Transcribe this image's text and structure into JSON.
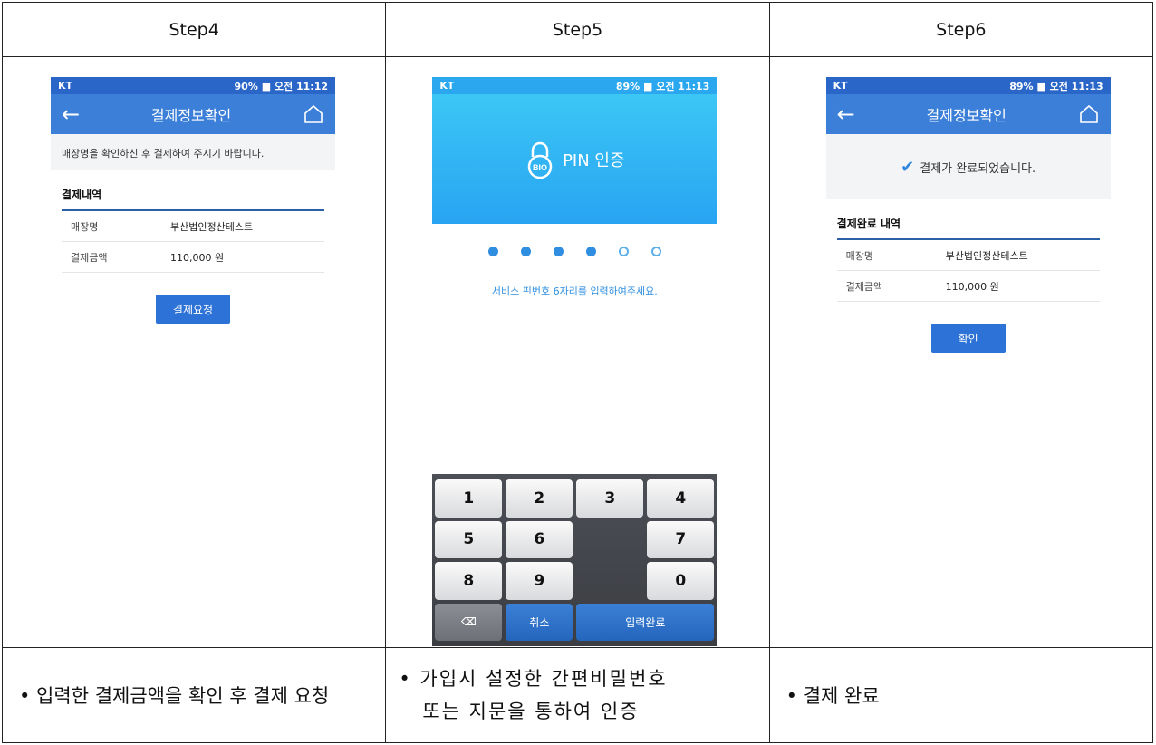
{
  "steps": [
    {
      "label": "Step4",
      "description": "• 입력한 결제금액을 확인 후 결제 요청"
    },
    {
      "label": "Step5",
      "description_line1": "• 가입시 설정한 간편비밀번호",
      "description_line2": "또는 지문을 통하여 인증"
    },
    {
      "label": "Step6",
      "description": "• 결제 완료"
    }
  ],
  "status": {
    "carrier": "KT",
    "step4_right": "90% ■ 오전 11:12",
    "step5_right": "89% ■ 오전 11:13",
    "step6_right": "89% ■ 오전 11:13"
  },
  "step4": {
    "title": "결제정보확인",
    "notice": "매장명을 확인하신 후 결제하여 주시기 바랍니다.",
    "section_title": "결제내역",
    "rows": [
      {
        "key": "매장명",
        "value": "부산법인정산테스트"
      },
      {
        "key": "결제금액",
        "value": "110,000 원"
      }
    ],
    "button": "결제요청"
  },
  "step5": {
    "heading": "PIN 인증",
    "lock_label": "BIO",
    "pin_filled": 4,
    "pin_total": 6,
    "message": "서비스 핀번호 6자리를 입력하여주세요.",
    "keys": [
      "1",
      "2",
      "3",
      "4",
      "5",
      "6",
      "7",
      "8",
      "9",
      "0"
    ],
    "delete_key": "⌫",
    "cancel_key": "취소",
    "done_key": "입력완료"
  },
  "step6": {
    "title": "결제정보확인",
    "notice": "결제가 완료되었습니다.",
    "section_title": "결제완료 내역",
    "rows": [
      {
        "key": "매장명",
        "value": "부산법인정산테스트"
      },
      {
        "key": "결제금액",
        "value": "110,000 원"
      }
    ],
    "button": "확인"
  },
  "colors": {
    "appbar": "#3b7fd9",
    "accent": "#2f8ee0",
    "button": "#2d72d6"
  }
}
